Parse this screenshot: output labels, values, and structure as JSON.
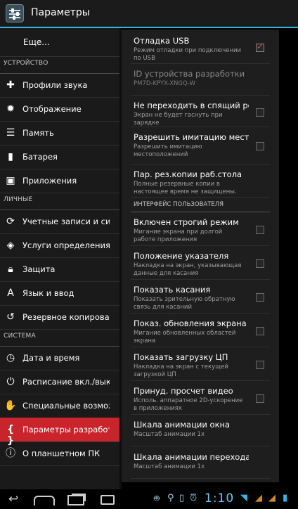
{
  "action_bar": {
    "title": "Параметры"
  },
  "sidebar": {
    "top_item": "Еще...",
    "sections": [
      {
        "header": "УСТРОЙСТВО",
        "items": [
          "Профили звука",
          "Отображение",
          "Память",
          "Батарея",
          "Приложения"
        ]
      },
      {
        "header": "ЛИЧНЫЕ",
        "items": [
          "Учетные записи и синхронизация",
          "Услуги определения местоположения",
          "Защита",
          "Язык и ввод",
          "Резервное копирование и сброс"
        ]
      },
      {
        "header": "СИСТЕМА",
        "items": [
          "Дата и время",
          "Расписание вкл./выкл.",
          "Специальные возможности",
          "Параметры разработчика",
          "О планшетном ПК"
        ]
      }
    ],
    "active_item": "Параметры разработчика"
  },
  "content": {
    "items": [
      {
        "title": "Отладка USB",
        "summary": "Режим отладки при подключении по USB",
        "checked": true
      },
      {
        "title": "ID устройства разработки",
        "summary": "PM7D-KPYX-XNGQ-W"
      },
      {
        "title": "Не переходить в спящий режим",
        "summary": "Экран не будет гаснуть при зарядке",
        "checked": false
      },
      {
        "title": "Разрешить имитацию местоположения",
        "summary": "Разрешить имитацию местоположений",
        "checked": false
      },
      {
        "title": "Пар. рез.копии раб.стола",
        "summary": "Полные резервные копии в настоящее время не защищены."
      }
    ],
    "ui_header": "ИНТЕРФЕЙС ПОЛЬЗОВАТЕЛЯ",
    "ui_items": [
      {
        "title": "Включен строгий режим",
        "summary": "Мигание экрана при долгой работе приложения",
        "checked": false
      },
      {
        "title": "Положение указателя",
        "summary": "Накладка на экран, указывающая данные для касания",
        "checked": false
      },
      {
        "title": "Показать касания",
        "summary": "Показать зрительную обратную связь для касаний",
        "checked": false
      },
      {
        "title": "Показ. обновления экрана",
        "summary": "Мигание обновленных областей экрана",
        "checked": false
      },
      {
        "title": "Показать загрузку ЦП",
        "summary": "Накладка на экран с текущей загрузкой ЦП",
        "checked": false
      },
      {
        "title": "Принуд. просчет видео",
        "summary": "Исполь. аппаратное 2D-ускорение в приложениях",
        "checked": false
      },
      {
        "title": "Шкала анимации окна",
        "summary": "Масштаб анимации 1x"
      },
      {
        "title": "Шкала анимации перехода",
        "summary": "Масштаб анимации 1x"
      }
    ]
  },
  "status_bar": {
    "time": "1:10",
    "accent_color": "#33b5e5"
  }
}
